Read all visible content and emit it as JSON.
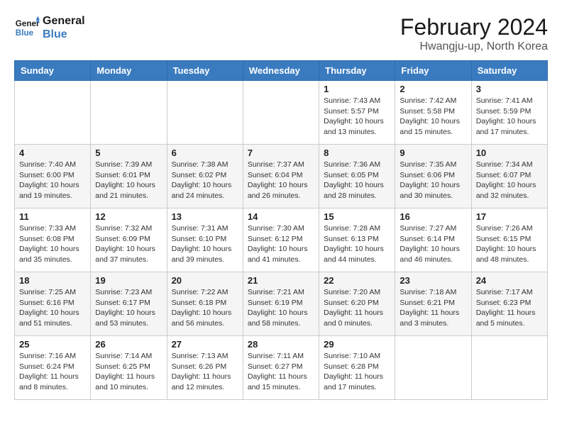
{
  "logo": {
    "line1": "General",
    "line2": "Blue"
  },
  "title": "February 2024",
  "location": "Hwangju-up, North Korea",
  "days_of_week": [
    "Sunday",
    "Monday",
    "Tuesday",
    "Wednesday",
    "Thursday",
    "Friday",
    "Saturday"
  ],
  "weeks": [
    [
      {
        "day": "",
        "info": ""
      },
      {
        "day": "",
        "info": ""
      },
      {
        "day": "",
        "info": ""
      },
      {
        "day": "",
        "info": ""
      },
      {
        "day": "1",
        "info": "Sunrise: 7:43 AM\nSunset: 5:57 PM\nDaylight: 10 hours\nand 13 minutes."
      },
      {
        "day": "2",
        "info": "Sunrise: 7:42 AM\nSunset: 5:58 PM\nDaylight: 10 hours\nand 15 minutes."
      },
      {
        "day": "3",
        "info": "Sunrise: 7:41 AM\nSunset: 5:59 PM\nDaylight: 10 hours\nand 17 minutes."
      }
    ],
    [
      {
        "day": "4",
        "info": "Sunrise: 7:40 AM\nSunset: 6:00 PM\nDaylight: 10 hours\nand 19 minutes."
      },
      {
        "day": "5",
        "info": "Sunrise: 7:39 AM\nSunset: 6:01 PM\nDaylight: 10 hours\nand 21 minutes."
      },
      {
        "day": "6",
        "info": "Sunrise: 7:38 AM\nSunset: 6:02 PM\nDaylight: 10 hours\nand 24 minutes."
      },
      {
        "day": "7",
        "info": "Sunrise: 7:37 AM\nSunset: 6:04 PM\nDaylight: 10 hours\nand 26 minutes."
      },
      {
        "day": "8",
        "info": "Sunrise: 7:36 AM\nSunset: 6:05 PM\nDaylight: 10 hours\nand 28 minutes."
      },
      {
        "day": "9",
        "info": "Sunrise: 7:35 AM\nSunset: 6:06 PM\nDaylight: 10 hours\nand 30 minutes."
      },
      {
        "day": "10",
        "info": "Sunrise: 7:34 AM\nSunset: 6:07 PM\nDaylight: 10 hours\nand 32 minutes."
      }
    ],
    [
      {
        "day": "11",
        "info": "Sunrise: 7:33 AM\nSunset: 6:08 PM\nDaylight: 10 hours\nand 35 minutes."
      },
      {
        "day": "12",
        "info": "Sunrise: 7:32 AM\nSunset: 6:09 PM\nDaylight: 10 hours\nand 37 minutes."
      },
      {
        "day": "13",
        "info": "Sunrise: 7:31 AM\nSunset: 6:10 PM\nDaylight: 10 hours\nand 39 minutes."
      },
      {
        "day": "14",
        "info": "Sunrise: 7:30 AM\nSunset: 6:12 PM\nDaylight: 10 hours\nand 41 minutes."
      },
      {
        "day": "15",
        "info": "Sunrise: 7:28 AM\nSunset: 6:13 PM\nDaylight: 10 hours\nand 44 minutes."
      },
      {
        "day": "16",
        "info": "Sunrise: 7:27 AM\nSunset: 6:14 PM\nDaylight: 10 hours\nand 46 minutes."
      },
      {
        "day": "17",
        "info": "Sunrise: 7:26 AM\nSunset: 6:15 PM\nDaylight: 10 hours\nand 48 minutes."
      }
    ],
    [
      {
        "day": "18",
        "info": "Sunrise: 7:25 AM\nSunset: 6:16 PM\nDaylight: 10 hours\nand 51 minutes."
      },
      {
        "day": "19",
        "info": "Sunrise: 7:23 AM\nSunset: 6:17 PM\nDaylight: 10 hours\nand 53 minutes."
      },
      {
        "day": "20",
        "info": "Sunrise: 7:22 AM\nSunset: 6:18 PM\nDaylight: 10 hours\nand 56 minutes."
      },
      {
        "day": "21",
        "info": "Sunrise: 7:21 AM\nSunset: 6:19 PM\nDaylight: 10 hours\nand 58 minutes."
      },
      {
        "day": "22",
        "info": "Sunrise: 7:20 AM\nSunset: 6:20 PM\nDaylight: 11 hours\nand 0 minutes."
      },
      {
        "day": "23",
        "info": "Sunrise: 7:18 AM\nSunset: 6:21 PM\nDaylight: 11 hours\nand 3 minutes."
      },
      {
        "day": "24",
        "info": "Sunrise: 7:17 AM\nSunset: 6:23 PM\nDaylight: 11 hours\nand 5 minutes."
      }
    ],
    [
      {
        "day": "25",
        "info": "Sunrise: 7:16 AM\nSunset: 6:24 PM\nDaylight: 11 hours\nand 8 minutes."
      },
      {
        "day": "26",
        "info": "Sunrise: 7:14 AM\nSunset: 6:25 PM\nDaylight: 11 hours\nand 10 minutes."
      },
      {
        "day": "27",
        "info": "Sunrise: 7:13 AM\nSunset: 6:26 PM\nDaylight: 11 hours\nand 12 minutes."
      },
      {
        "day": "28",
        "info": "Sunrise: 7:11 AM\nSunset: 6:27 PM\nDaylight: 11 hours\nand 15 minutes."
      },
      {
        "day": "29",
        "info": "Sunrise: 7:10 AM\nSunset: 6:28 PM\nDaylight: 11 hours\nand 17 minutes."
      },
      {
        "day": "",
        "info": ""
      },
      {
        "day": "",
        "info": ""
      }
    ]
  ]
}
